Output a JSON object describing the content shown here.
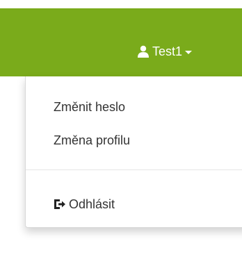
{
  "colors": {
    "navbar_bg": "#7aab1b",
    "navbar_text": "#ffffff",
    "menu_text": "#333333",
    "divider": "#e5e5e5"
  },
  "navbar": {
    "user": {
      "icon": "user-icon",
      "name": "Test1",
      "caret_icon": "caret-down-icon"
    }
  },
  "dropdown": {
    "items": [
      {
        "label": "Změnit heslo"
      },
      {
        "label": "Změna profilu"
      }
    ],
    "logout": {
      "icon": "logout-icon",
      "label": "Odhlásit"
    }
  }
}
